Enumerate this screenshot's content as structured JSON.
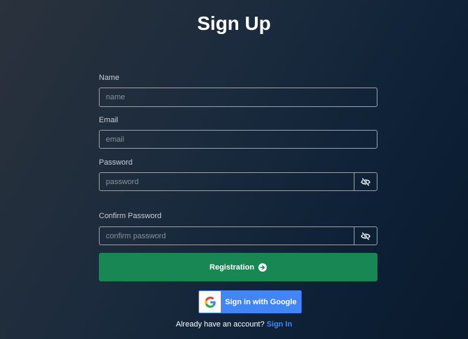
{
  "page": {
    "title": "Sign Up"
  },
  "form": {
    "name": {
      "label": "Name",
      "placeholder": "name",
      "value": ""
    },
    "email": {
      "label": "Email",
      "placeholder": "email",
      "value": ""
    },
    "password": {
      "label": "Password",
      "placeholder": "password",
      "value": "",
      "toggle_icon": "eye-slash-icon"
    },
    "confirm_password": {
      "label": "Confirm Password",
      "placeholder": "confirm password",
      "value": "",
      "toggle_icon": "eye-slash-icon"
    },
    "submit": {
      "label": "Registration",
      "icon": "arrow-right-circle-icon",
      "color": "#198754"
    }
  },
  "google": {
    "label": "Sign in with Google",
    "icon": "google-g-icon",
    "color": "#4285f4"
  },
  "footer": {
    "prompt": "Already have an account?",
    "link_label": "Sign In",
    "link_color": "#3d8bfd"
  }
}
